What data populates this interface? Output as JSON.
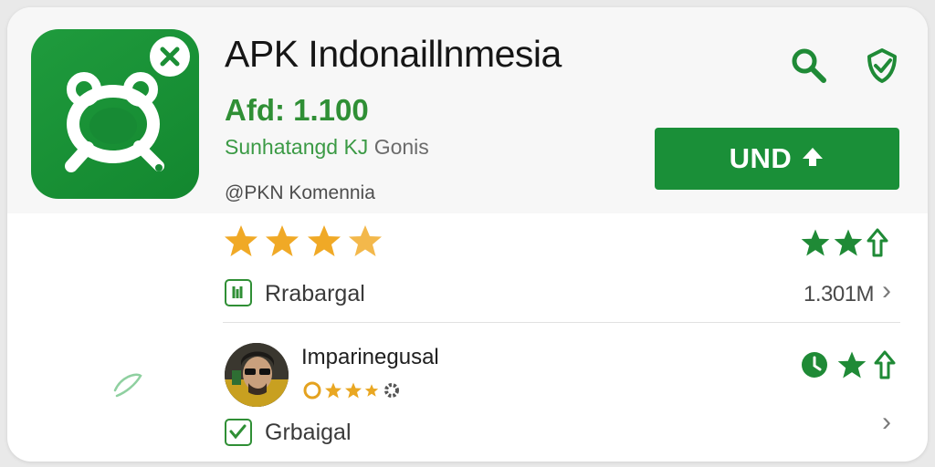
{
  "app": {
    "title": "APK Indonaillnmesia",
    "version": "Afd: 1.100",
    "subtitle_green": "Sunhatangd KJ",
    "subtitle_gray": "Gonis",
    "category": "@PKN Komennia",
    "install_label": "UND",
    "icon": "app-logo-icon"
  },
  "header_icons": [
    "search-icon",
    "shield-check-icon"
  ],
  "rating": {
    "stars": 3.5,
    "right_indicator": "2 stars + arrow-up"
  },
  "rows": [
    {
      "label": "Rrabargal",
      "value": "1.301M",
      "icon": "rating-box-icon"
    },
    {
      "label": "Grbaigal",
      "value": "",
      "icon": "check-box-icon"
    }
  ],
  "review": {
    "reviewer_name": "Imparinegusal",
    "mini_rating_text": "",
    "avatar": "reviewer-avatar"
  },
  "colors": {
    "brand_green": "#1a8f38",
    "text_green": "#2f8f35",
    "star_gold": "#f0a926"
  }
}
